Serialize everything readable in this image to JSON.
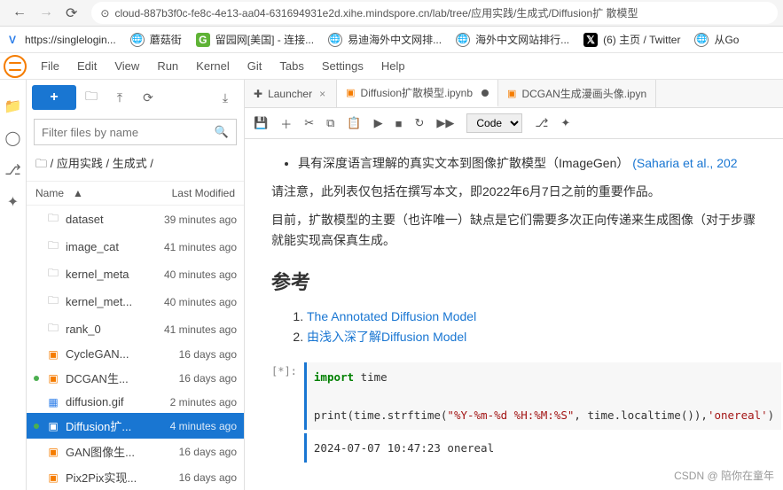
{
  "browser": {
    "url": "cloud-887b3f0c-fe8c-4e13-aa04-631694931e2d.xihe.mindspore.cn/lab/tree/应用实践/生成式/Diffusion扩 散模型",
    "bookmarks": [
      {
        "label": "https://singlelogin...",
        "icon": "v"
      },
      {
        "label": "蘑菇街",
        "icon": "globe"
      },
      {
        "label": "留园网[美国] - 连接...",
        "icon": "g"
      },
      {
        "label": "易迪海外中文网排...",
        "icon": "globe"
      },
      {
        "label": "海外中文网站排行...",
        "icon": "globe"
      },
      {
        "label": "(6) 主页 / Twitter",
        "icon": "x"
      },
      {
        "label": "从Go",
        "icon": "globe"
      }
    ]
  },
  "menu": [
    "File",
    "Edit",
    "View",
    "Run",
    "Kernel",
    "Git",
    "Tabs",
    "Settings",
    "Help"
  ],
  "sidebar": {
    "filter_placeholder": "Filter files by name",
    "breadcrumb": "/ 应用实践 / 生成式 /",
    "header_name": "Name",
    "header_mod": "Last Modified",
    "files": [
      {
        "type": "folder",
        "name": "dataset",
        "time": "39 minutes ago"
      },
      {
        "type": "folder",
        "name": "image_cat",
        "time": "41 minutes ago"
      },
      {
        "type": "folder",
        "name": "kernel_meta",
        "time": "40 minutes ago"
      },
      {
        "type": "folder",
        "name": "kernel_met...",
        "time": "40 minutes ago"
      },
      {
        "type": "folder",
        "name": "rank_0",
        "time": "41 minutes ago"
      },
      {
        "type": "nb",
        "name": "CycleGAN...",
        "time": "16 days ago"
      },
      {
        "type": "nb",
        "name": "DCGAN生...",
        "time": "16 days ago",
        "running": true
      },
      {
        "type": "img",
        "name": "diffusion.gif",
        "time": "2 minutes ago"
      },
      {
        "type": "nb",
        "name": "Diffusion扩...",
        "time": "4 minutes ago",
        "running": true,
        "selected": true
      },
      {
        "type": "nb",
        "name": "GAN图像生...",
        "time": "16 days ago"
      },
      {
        "type": "nb",
        "name": "Pix2Pix实现...",
        "time": "16 days ago"
      }
    ]
  },
  "tabs": [
    {
      "label": "Launcher",
      "kind": "launcher",
      "closeable": true
    },
    {
      "label": "Diffusion扩散模型.ipynb",
      "kind": "nb",
      "active": true,
      "dirty": true
    },
    {
      "label": "DCGAN生成漫画头像.ipyn",
      "kind": "nb"
    }
  ],
  "toolbar": {
    "cell_type": "Code"
  },
  "content": {
    "bullet": "具有深度语言理解的真实文本到图像扩散模型（ImageGen）",
    "bullet_link": "(Saharia et al., 202",
    "p1": "请注意，此列表仅包括在撰写本文，即2022年6月7日之前的重要作品。",
    "p2": "目前，扩散模型的主要（也许唯一）缺点是它们需要多次正向传递来生成图像（对于步骤就能实现高保真生成。",
    "h2": "参考",
    "ref1": "The Annotated Diffusion Model",
    "ref2": "由浅入深了解Diffusion Model",
    "cell_prompt": "[*]:",
    "code_html": "<span class='kw'>import</span> time\n\nprint(time.strftime(<span class='str'>\"%Y-%m-%d %H:%M:%S\"</span>, time.localtime()),<span class='str'>'onereal'</span>)",
    "output": "2024-07-07 10:47:23 onereal"
  },
  "watermark": "CSDN @ 陪你在童年"
}
